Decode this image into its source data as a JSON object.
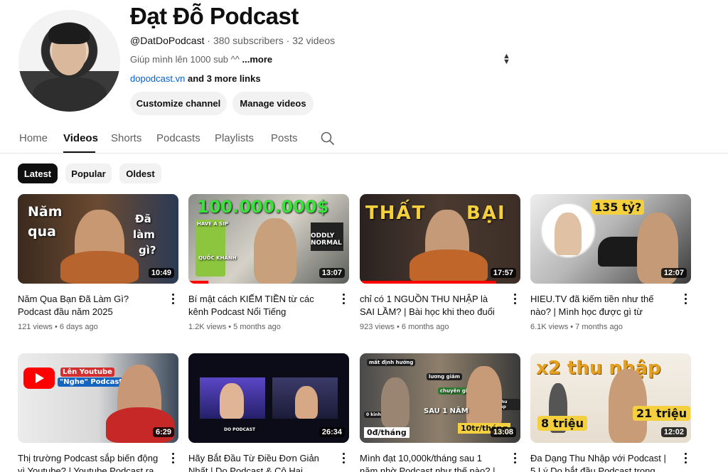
{
  "channel": {
    "name": "Đạt Đỗ Podcast",
    "handle": "@DatDoPodcast",
    "subscribers": "380 subscribers",
    "videos_count": "32 videos",
    "separator": "·",
    "description": "Giúp mình lên 1000 sub ^^",
    "more_label": "...more",
    "link": "dopodcast.vn",
    "more_links": "and 3 more links",
    "customize_label": "Customize channel",
    "manage_label": "Manage videos"
  },
  "tabs": [
    "Home",
    "Videos",
    "Shorts",
    "Podcasts",
    "Playlists",
    "Posts"
  ],
  "active_tab": "Videos",
  "chips": [
    "Latest",
    "Popular",
    "Oldest"
  ],
  "selected_chip": "Latest",
  "videos": [
    {
      "title": "Năm Qua Bạn Đã Làm Gì? Podcast đầu năm 2025",
      "views": "121 views",
      "age": "6 days ago",
      "duration": "10:49",
      "watched": 0.0,
      "thumb_text": [
        "Năm",
        "qua",
        "Đã",
        "làm",
        "gì?"
      ]
    },
    {
      "title": "Bí mật cách KIẾM TIỀN từ các kênh Podcast Nổi Tiếng",
      "views": "1.2K views",
      "age": "5 months ago",
      "duration": "13:07",
      "watched": 0.12,
      "thumb_text": [
        "100.000.000$",
        "HAVE A SIP",
        "QUỐC KHÁNH",
        "ODDLY NORMAL"
      ]
    },
    {
      "title": "chỉ có 1 NGUỒN THU NHẬP là SAI LẦM? | Bài học khi theo đuổi ĐAM...",
      "views": "923 views",
      "age": "6 months ago",
      "duration": "17:57",
      "watched": 0.85,
      "thumb_text": [
        "THẤT",
        "BẠI"
      ]
    },
    {
      "title": "HIEU.TV đã kiếm tiền như thế nào? | Mình học được gì từ Podcast...",
      "views": "6.1K views",
      "age": "7 months ago",
      "duration": "12:07",
      "watched": 0.0,
      "thumb_text": [
        "135 tỷ?"
      ]
    },
    {
      "title": "Thị trường Podcast sắp biến động vì Youtube? | Youtube Podcast ra mắt",
      "views": "",
      "age": "",
      "duration": "6:29",
      "watched": 0.0,
      "thumb_text": [
        "Lên Youtube",
        "\"Nghe\" Podcast?"
      ]
    },
    {
      "title": "Hãy Bắt Đầu Từ Điều Đơn Giản Nhất | Do Podcast & Cô Hai Podcast",
      "views": "",
      "age": "",
      "duration": "26:34",
      "watched": 0.0,
      "thumb_text": [
        "DO PODCAST"
      ]
    },
    {
      "title": "Mình đạt 10,000k/tháng sau 1 năm nhờ Podcast như thế nào? | Hành",
      "views": "",
      "age": "",
      "duration": "13:08",
      "watched": 0.0,
      "thumb_text": [
        "0đ/tháng",
        "10tr/tháng",
        "SAU 1 NĂM",
        "mất định hướng",
        "lương giảm",
        "chuyên gia",
        "0 kinh nghiệm",
        "+ thu nhập"
      ]
    },
    {
      "title": "Đa Dạng Thu Nhập với Podcast | 5 Lý Do bắt đầu Podcast trong năm",
      "views": "",
      "age": "",
      "duration": "12:02",
      "watched": 0.0,
      "thumb_text": [
        "x2 thu nhập",
        "8 triệu",
        "21 triệu"
      ]
    }
  ],
  "colors": {
    "accent": "#ff0000",
    "link": "#065fd4",
    "chip_selected": "#0f0f0f"
  }
}
